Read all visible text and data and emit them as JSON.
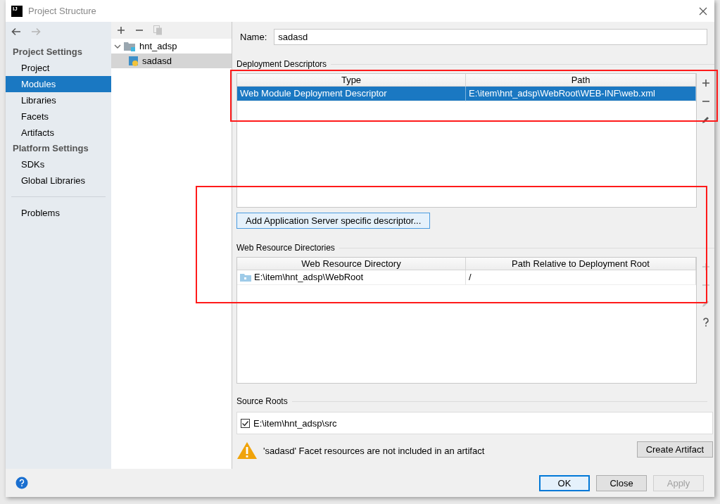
{
  "window": {
    "logo": "IJ",
    "title": "Project Structure"
  },
  "sidebar": {
    "sections": [
      {
        "heading": "Project Settings",
        "items": [
          {
            "label": "Project",
            "selected": false
          },
          {
            "label": "Modules",
            "selected": true
          },
          {
            "label": "Libraries",
            "selected": false
          },
          {
            "label": "Facets",
            "selected": false
          },
          {
            "label": "Artifacts",
            "selected": false
          }
        ]
      },
      {
        "heading": "Platform Settings",
        "items": [
          {
            "label": "SDKs",
            "selected": false
          },
          {
            "label": "Global Libraries",
            "selected": false
          }
        ]
      }
    ],
    "footer_items": [
      {
        "label": "Problems",
        "selected": false
      }
    ]
  },
  "tree": {
    "nodes": [
      {
        "label": "hnt_adsp",
        "expanded": true,
        "selected": false,
        "children": [
          {
            "label": "sadasd",
            "selected": true
          }
        ]
      }
    ]
  },
  "name_field": {
    "label": "Name:",
    "value": "sadasd"
  },
  "deployment_descriptors": {
    "title": "Deployment Descriptors",
    "columns": [
      "Type",
      "Path"
    ],
    "rows": [
      {
        "cells": [
          "Web Module Deployment Descriptor",
          "E:\\item\\hnt_adsp\\WebRoot\\WEB-INF\\web.xml"
        ],
        "selected": true
      }
    ],
    "tools": [
      {
        "kind": "add",
        "disabled": false
      },
      {
        "kind": "remove",
        "disabled": false
      },
      {
        "kind": "edit",
        "disabled": false
      }
    ]
  },
  "add_descriptor_button": "Add Application Server specific descriptor...",
  "web_resource_directories": {
    "title": "Web Resource Directories",
    "columns": [
      "Web Resource Directory",
      "Path Relative to Deployment Root"
    ],
    "rows": [
      {
        "cells": [
          "E:\\item\\hnt_adsp\\WebRoot",
          "/"
        ],
        "selected": false
      }
    ],
    "tools": [
      {
        "kind": "add",
        "disabled": true
      },
      {
        "kind": "remove",
        "disabled": true
      },
      {
        "kind": "edit",
        "disabled": true
      },
      {
        "kind": "help",
        "disabled": false
      }
    ]
  },
  "source_roots": {
    "title": "Source Roots",
    "items": [
      {
        "label": "E:\\item\\hnt_adsp\\src",
        "checked": true
      }
    ]
  },
  "warning": {
    "message": "'sadasd' Facet resources are not included in an artifact",
    "button": "Create Artifact"
  },
  "buttons": [
    {
      "label": "OK",
      "kind": "default",
      "disabled": false
    },
    {
      "label": "Close",
      "kind": "normal",
      "disabled": false
    },
    {
      "label": "Apply",
      "kind": "normal",
      "disabled": true
    }
  ],
  "annotations": [
    {
      "kind": "rectangle",
      "color": "#ff1a1a"
    },
    {
      "kind": "rectangle",
      "color": "#ff1a1a"
    }
  ]
}
